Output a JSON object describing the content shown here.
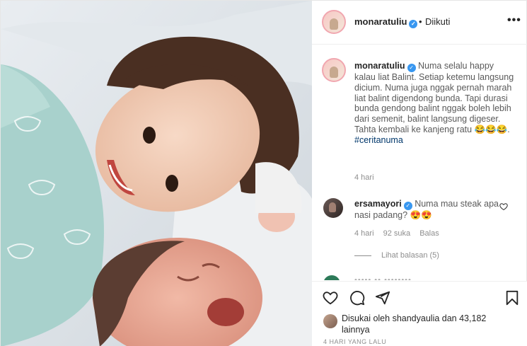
{
  "post": {
    "username": "monaratuliu",
    "separator": "•",
    "follow_status": "Diikuti",
    "more_label": "•••",
    "caption": {
      "username": "monaratuliu",
      "text": "Numa selalu happy kalau liat Balint. Setiap ketemu langsung dicium. Numa juga nggak pernah marah liat balint digendong bunda. Tapi durasi bunda gendong balint nggak boleh lebih dari semenit, balint langsung digeser. Tahta kembali ke kanjeng ratu 😂😂😂.",
      "hashtag": "#ceritanuma",
      "time": "4 hari"
    },
    "comment": {
      "username": "ersamayori",
      "text": "Numa mau steak apa nasi padang? 😍😍",
      "time": "4 hari",
      "likes": "92 suka",
      "reply_label": "Balas",
      "view_replies": "Lihat balasan (5)"
    },
    "partial_comment": "••••• •• ••••••••",
    "likes": {
      "prefix": "Disukai oleh",
      "user": "shandyaulia",
      "suffix": "dan 43,182 lainnya"
    },
    "timestamp": "4 HARI YANG LALU"
  },
  "icons": {
    "verified": "verified-badge-icon",
    "heart": "heart-icon",
    "comment": "comment-icon",
    "share": "share-icon",
    "save": "bookmark-icon"
  },
  "colors": {
    "verified": "#3897f0",
    "text": "#262626",
    "muted": "#8e8e8e",
    "hashtag": "#00376b"
  }
}
